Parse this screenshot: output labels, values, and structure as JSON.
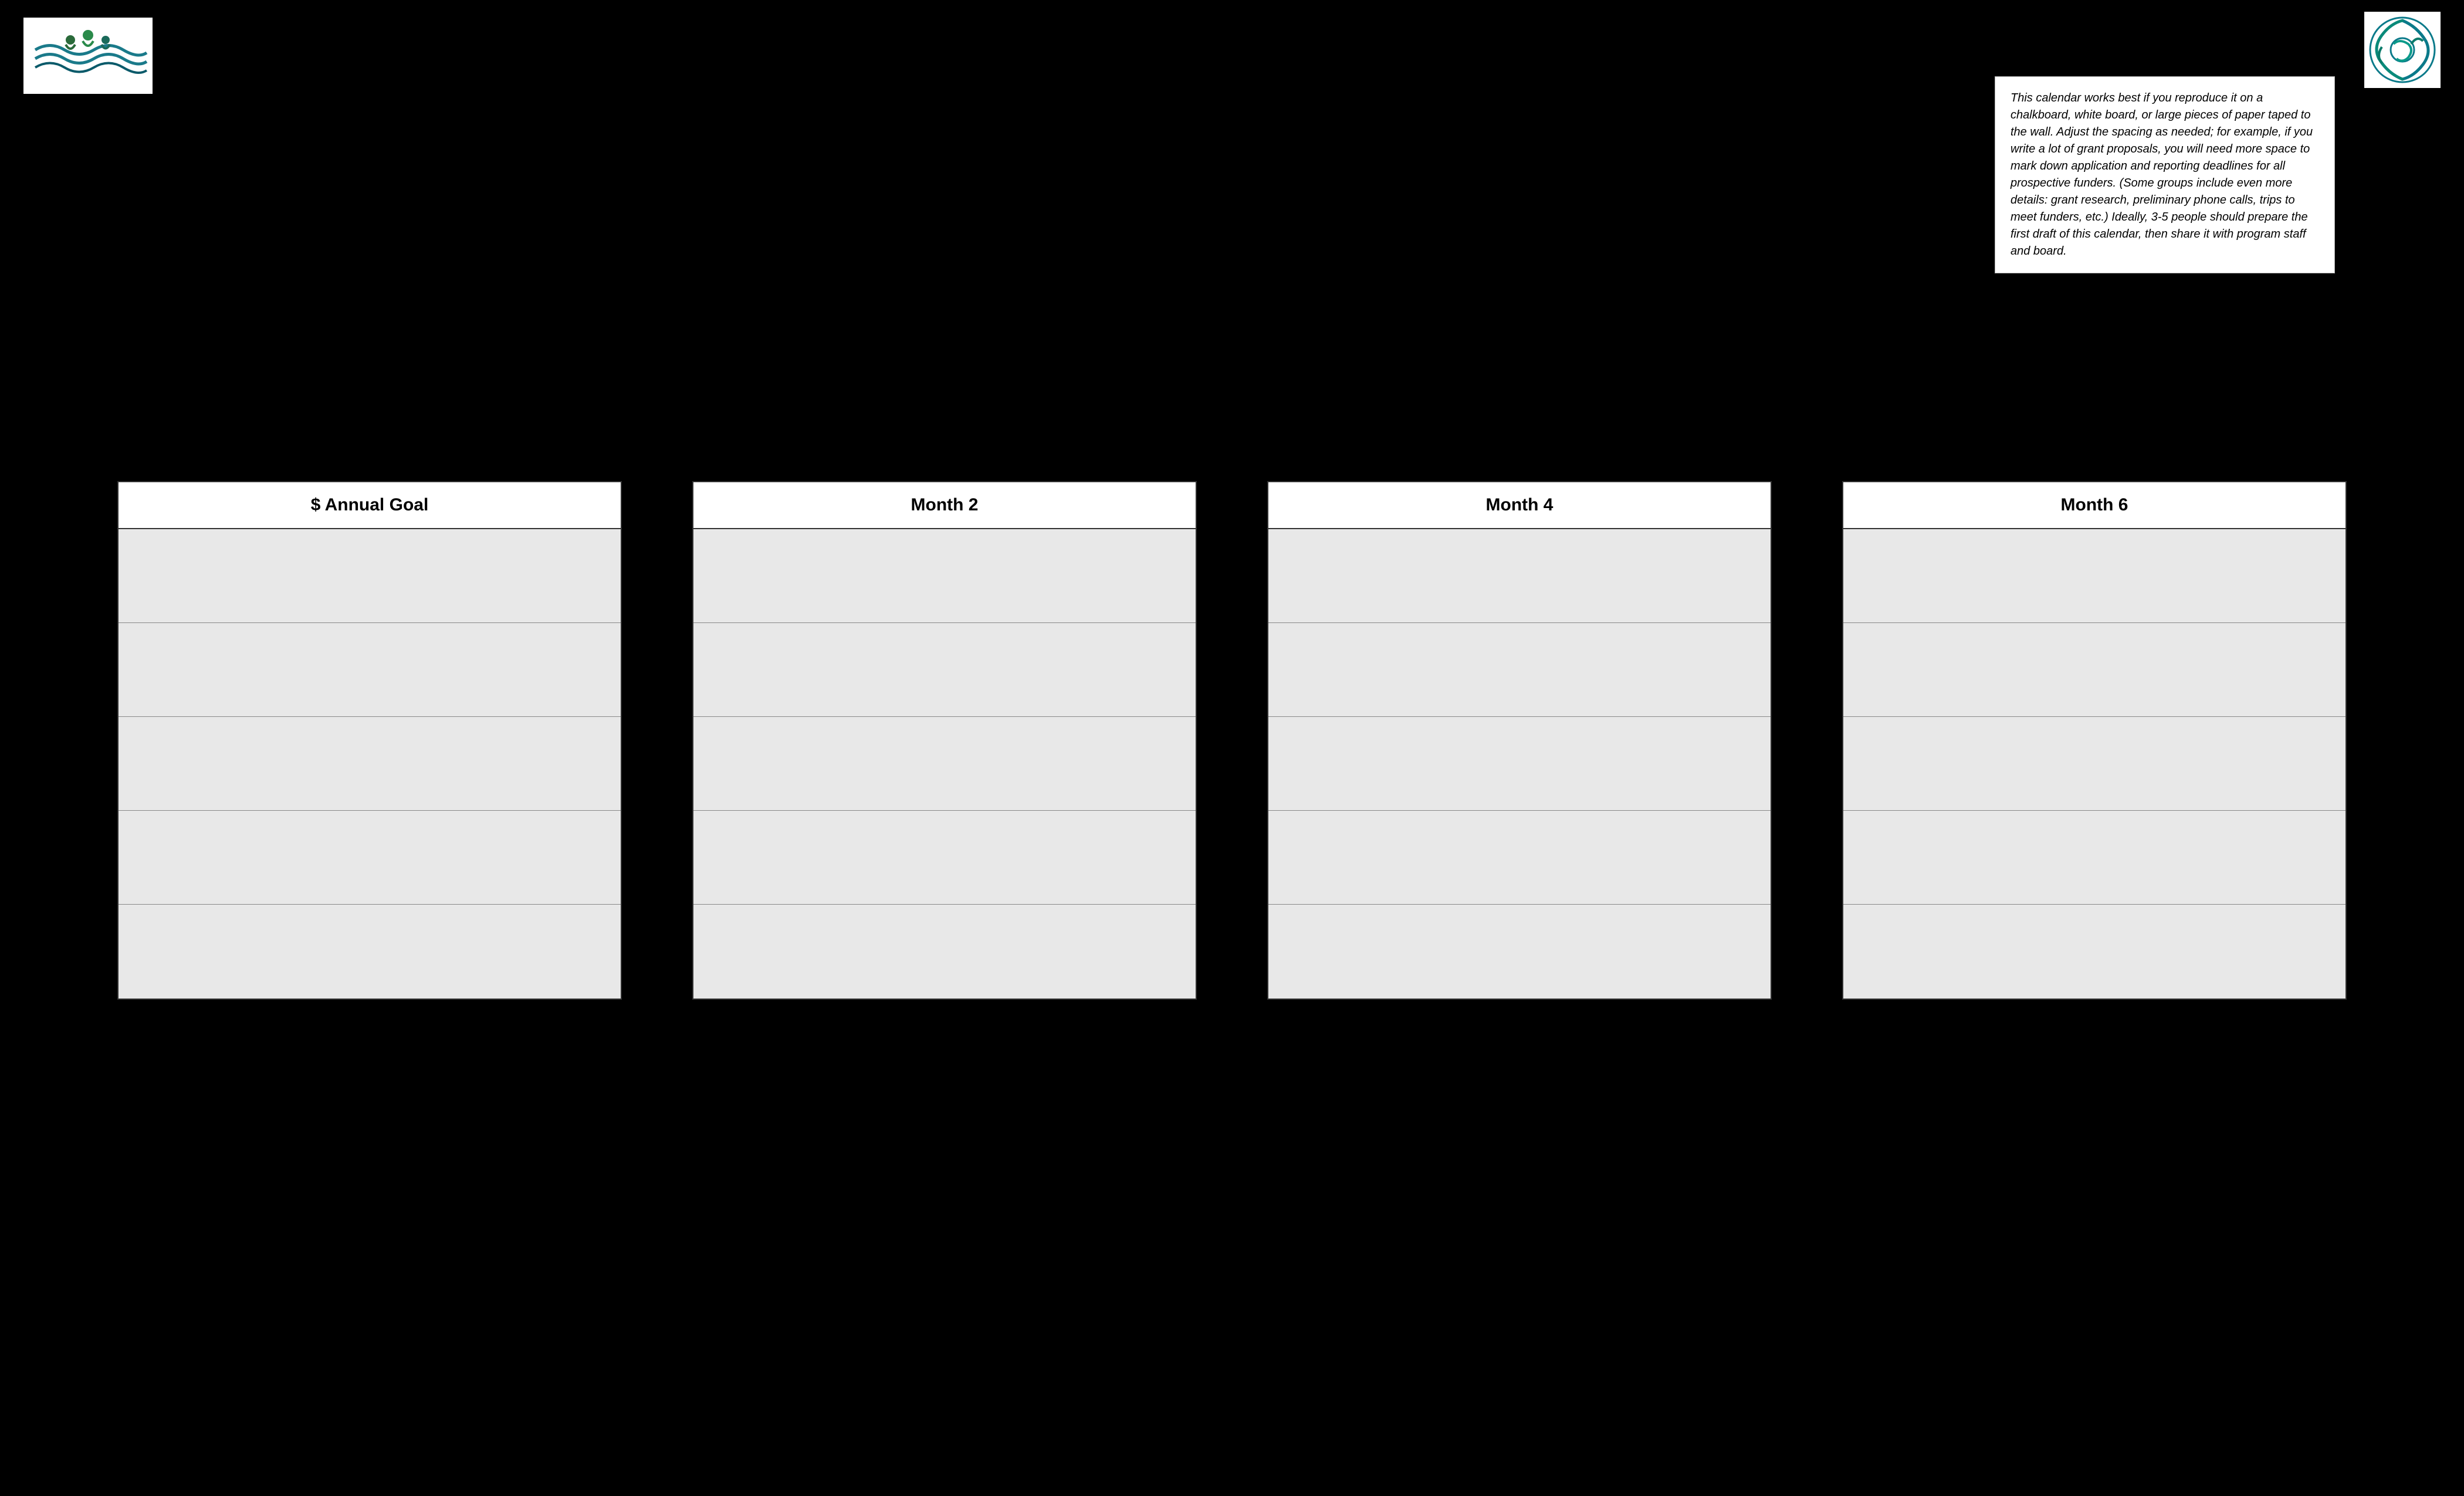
{
  "logos": {
    "left": {
      "alt": "Organization logo left",
      "description": "Waves and people logo"
    },
    "right": {
      "alt": "Organization logo right",
      "description": "Circular swirls logo"
    }
  },
  "info_box": {
    "text": "This calendar works best if you reproduce it on a chalkboard, white board, or large pieces of paper taped to the wall.  Adjust the spacing as needed; for example, if you write a lot of grant proposals, you will need more space to mark down application and reporting deadlines for all prospective funders. (Some groups include even more details: grant research, preliminary phone calls, trips to meet funders, etc.)  Ideally, 3-5 people should prepare the first draft of this calendar, then share it with program staff and board."
  },
  "columns": [
    {
      "id": "col-annual",
      "header": "$ Annual Goal",
      "rows": 5
    },
    {
      "id": "col-month2",
      "header": "Month 2",
      "rows": 5
    },
    {
      "id": "col-month4",
      "header": "Month 4",
      "rows": 5
    },
    {
      "id": "col-month6",
      "header": "Month 6",
      "rows": 5
    }
  ],
  "colors": {
    "background": "#000000",
    "column_bg": "#ffffff",
    "row_bg": "#e8e8e8",
    "border": "#333333",
    "row_border": "#888888",
    "info_bg": "#ffffff",
    "info_border": "#aaaaaa"
  }
}
